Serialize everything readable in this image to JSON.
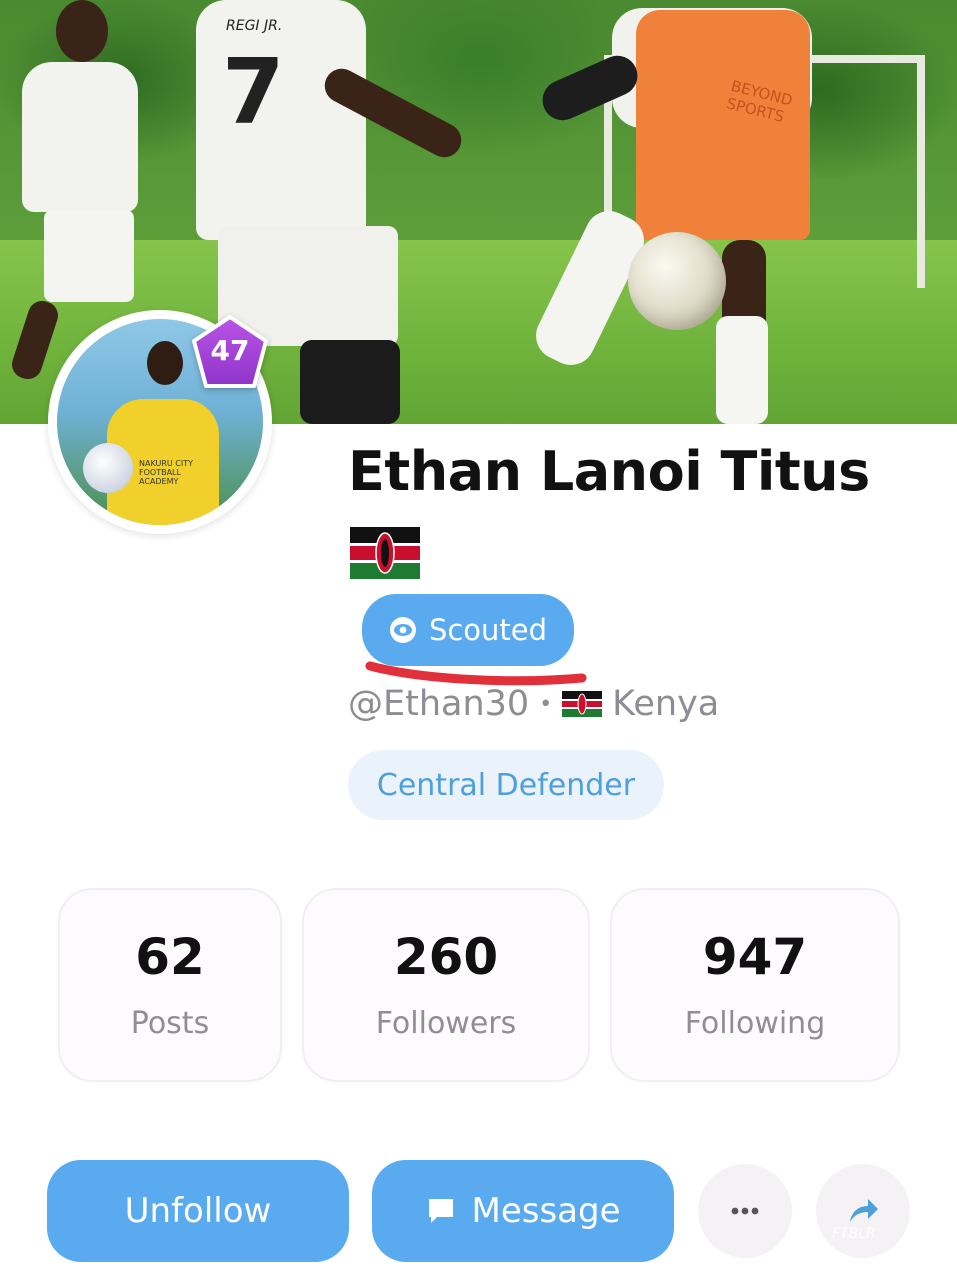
{
  "profile": {
    "name": "Ethan Lanoi Titus",
    "level": "47",
    "status_badge": "Scouted",
    "handle": "@Ethan30",
    "separator": "•",
    "country": "Kenya",
    "position": "Central Defender",
    "flag_icon": "kenya-flag-icon"
  },
  "stats": [
    {
      "value": "62",
      "label": "Posts"
    },
    {
      "value": "260",
      "label": "Followers"
    },
    {
      "value": "947",
      "label": "Following"
    }
  ],
  "actions": {
    "unfollow_label": "Unfollow",
    "message_label": "Message",
    "more_icon": "ellipsis-icon",
    "share_icon": "share-arrow-icon"
  },
  "cover": {
    "jersey_text": "REGI JR.",
    "jersey_number": "7",
    "bib_text": "BEYOND SPORTS"
  },
  "avatar": {
    "shirt_text": "NAKURU CITY FOOTBALL ACADEMY"
  },
  "watermark": "FTBLR",
  "colors": {
    "accent": "#5aaaf0",
    "chip_bg": "#eaf3fc",
    "chip_text": "#4f9fdb",
    "level_badge": "#a645d8",
    "annotation_red": "#e0303a"
  }
}
